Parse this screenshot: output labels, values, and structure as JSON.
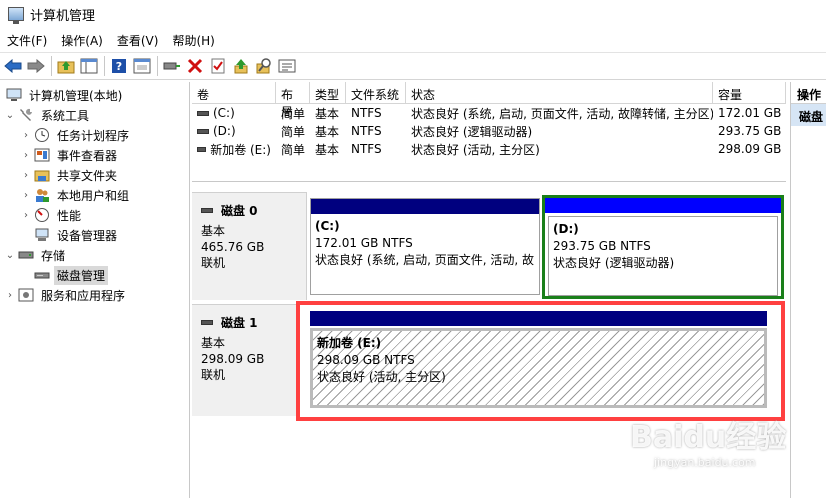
{
  "window": {
    "title": "计算机管理"
  },
  "menu": [
    "文件(F)",
    "操作(A)",
    "查看(V)",
    "帮助(H)"
  ],
  "toolbar_icons": [
    "back-icon",
    "forward-icon",
    "up-folder-icon",
    "show-tree-icon",
    "help-icon",
    "properties-icon",
    "connect-icon",
    "delete-icon",
    "check-icon",
    "up-arrow-icon",
    "search-icon",
    "list-icon"
  ],
  "tree": {
    "root": "计算机管理(本地)",
    "system_tools": "系统工具",
    "items": [
      "任务计划程序",
      "事件查看器",
      "共享文件夹",
      "本地用户和组",
      "性能",
      "设备管理器"
    ],
    "storage": "存储",
    "disk_management": "磁盘管理",
    "services": "服务和应用程序"
  },
  "volume_table": {
    "headers": [
      "卷",
      "布局",
      "类型",
      "文件系统",
      "状态",
      "容量"
    ],
    "rows": [
      [
        "(C:)",
        "简单",
        "基本",
        "NTFS",
        "状态良好 (系统, 启动, 页面文件, 活动, 故障转储, 主分区)",
        "172.01 GB"
      ],
      [
        "(D:)",
        "简单",
        "基本",
        "NTFS",
        "状态良好 (逻辑驱动器)",
        "293.75 GB"
      ],
      [
        "新加卷 (E:)",
        "简单",
        "基本",
        "NTFS",
        "状态良好 (活动, 主分区)",
        "298.09 GB"
      ]
    ]
  },
  "disks": [
    {
      "name": "磁盘 0",
      "type": "基本",
      "size": "465.76 GB",
      "status": "联机",
      "partitions": [
        {
          "name": "(C:)",
          "size": "172.01 GB NTFS",
          "status": "状态良好 (系统, 启动, 页面文件, 活动, 故"
        },
        {
          "name": "(D:)",
          "size": "293.75 GB NTFS",
          "status": "状态良好 (逻辑驱动器)"
        }
      ]
    },
    {
      "name": "磁盘 1",
      "type": "基本",
      "size": "298.09 GB",
      "status": "联机",
      "partitions": [
        {
          "name": "新加卷 (E:)",
          "size": "298.09 GB NTFS",
          "status": "状态良好 (活动, 主分区)"
        }
      ]
    }
  ],
  "actions": {
    "header": "操作",
    "item": "磁盘"
  },
  "watermark": {
    "main": "Baidu经验",
    "sub": "jingyan.baidu.com"
  },
  "colors": {
    "primary_bar": "#00007f",
    "logical_bar": "#0000ff",
    "d_highlight": "#1a7f1a",
    "e_highlight": "#ff4040"
  }
}
